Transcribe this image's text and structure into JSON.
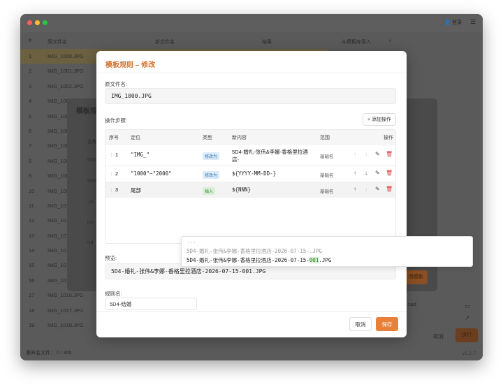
{
  "titlebar": {
    "user_label": "登录",
    "menu_glyph": "☰",
    "user_glyph": "👤"
  },
  "columns": {
    "idx": "#",
    "original": "原文件名",
    "new": "新文件名",
    "result": "结果",
    "import_label": "从模板库导入",
    "add_glyph": "+"
  },
  "file_rows": [
    {
      "idx": "1",
      "name": "IMG_1000.JPG"
    },
    {
      "idx": "2",
      "name": "IMG_1001.JPG"
    },
    {
      "idx": "3",
      "name": "IMG_1002.JPG"
    },
    {
      "idx": "4",
      "name": "IMG_100"
    },
    {
      "idx": "5",
      "name": "IMG_100"
    },
    {
      "idx": "6",
      "name": "IMG_100"
    },
    {
      "idx": "7",
      "name": "IMG_100"
    },
    {
      "idx": "8",
      "name": "IMG_100"
    },
    {
      "idx": "9",
      "name": "IMG_100"
    },
    {
      "idx": "10",
      "name": "IMG_100"
    },
    {
      "idx": "11",
      "name": "IMG_101"
    },
    {
      "idx": "12",
      "name": "IMG_101"
    },
    {
      "idx": "13",
      "name": "IMG_101"
    },
    {
      "idx": "14",
      "name": "IMG_101"
    },
    {
      "idx": "15",
      "name": "IMG_101"
    },
    {
      "idx": "16",
      "name": "IMG_101"
    },
    {
      "idx": "17",
      "name": "IMG_1016.JPG"
    },
    {
      "idx": "18",
      "name": "IMG_1017.JPG"
    },
    {
      "idx": "19",
      "name": "IMG_1018.JPG"
    }
  ],
  "status": {
    "rename_label": "重命名文件：",
    "rename_count": "0 / 300",
    "version": "v1.2.7"
  },
  "bg_dialog": {
    "title": "模板规",
    "frag_name": "名称",
    "frag_5d": "5D4",
    "frag_5d2": "5D4",
    "frag_cs": ".cs",
    "frag_ico": "ico",
    "frag_rul": "rul",
    "use_btn": "用模板",
    "cancel": "取消",
    "run": "执行",
    "frag_nad": "nad"
  },
  "dialog": {
    "title": "模板规则 – 修改",
    "orig_label": "原文件名:",
    "orig_value": "IMG_1000.JPG",
    "steps_label": "操作步骤:",
    "add_btn": "添加操作",
    "add_glyph": "+",
    "headers": {
      "no": "序号",
      "pos": "定位",
      "type": "类型",
      "content": "新内容",
      "scope": "范围",
      "ops": "操作"
    },
    "steps": [
      {
        "no": "1",
        "pos": "\"IMG_\"",
        "type": "修改为",
        "content": "5D4-婚礼-张伟&李娜-香格里拉酒店-",
        "scope": "基础名"
      },
      {
        "no": "2",
        "pos": "\"1000\"~\"2000\"",
        "type": "修改为",
        "content": "${YYYY-MM-DD-}",
        "scope": "基础名"
      },
      {
        "no": "3",
        "pos": "尾部",
        "type": "插入",
        "content": "${NNN}",
        "scope": "基础名"
      }
    ],
    "preview_label": "预览:",
    "preview_value": "5D4-婚礼-张伟&李娜-香格里拉酒店-2026-07-15-001.JPG",
    "rule_label": "规则名:",
    "rule_value": "5D4-结婚",
    "cancel": "取消",
    "save": "保存"
  },
  "popup": {
    "dots": "...",
    "line1": "5D4-婚礼-张伟&李娜-香格里拉酒店-2026-07-15-.JPG",
    "line2_pre": "5D4-婚礼-张伟&李娜-香格里拉酒店-2026-07-15-",
    "line2_hl": "001",
    "line2_post": ".JPG"
  },
  "colors": {
    "accent": "#e8803a",
    "title": "#d4722c",
    "delete": "#d93b3b"
  }
}
